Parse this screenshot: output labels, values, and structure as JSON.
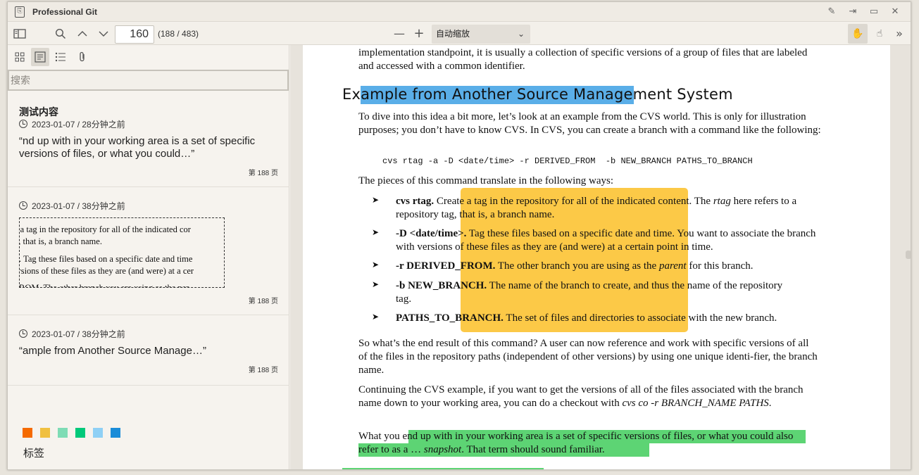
{
  "window": {
    "title": "Professional Git"
  },
  "toolbar": {
    "page_number": "160",
    "page_count": "(188 / 483)",
    "zoom": "自动缩放"
  },
  "sidebar": {
    "search_placeholder": "搜索",
    "notes": [
      {
        "title": "测试内容",
        "date": "2023-01-07 / 28分钟之前",
        "text": "“nd up with in your working area is a set of specific versions of files, or what you could…”",
        "page": "第 188 页"
      },
      {
        "date": "2023-01-07 / 38分钟之前",
        "snapshot_lines": [
          "e a tag in the repository for all of the indicated cor",
          "g, that is, a branch name.",
          ">. Tag these files based on a specific date and time",
          "ersions of these files as they are (and were) at a cer",
          "FROM. The other branch you are using as the par"
        ],
        "page": "第 188 页"
      },
      {
        "date": "2023-01-07 / 38分钟之前",
        "text": "“ample from Another Source Manage…”",
        "page": "第 188 页"
      }
    ],
    "tag_colors": [
      "#f56a00",
      "#f0c040",
      "#7edcb5",
      "#00c97a",
      "#8fd0f5",
      "#1a8cd8"
    ],
    "tag_label": "标签"
  },
  "doc": {
    "intro": "implementation standpoint, it is usually a collection of specific versions of a group of files that are labeled and accessed with a common identifier.",
    "heading": "Example from Another Source Management System",
    "para1": "To dive into this idea a bit more, let’s look at an example from the CVS world. This is only for illustration purposes; you don’t have to know CVS. In CVS, you can create a branch with a command like the following:",
    "code": "cvs rtag -a -D <date/time> -r DERIVED_FROM  -b NEW_BRANCH PATHS_TO_BRANCH",
    "para2": "The pieces of this command translate in the following ways:",
    "items": [
      {
        "term": "cvs rtag.",
        "desc_pre": " Create a tag in the repository for all of the indicated content. The ",
        "em": "rtag",
        "desc_post": " here refers to a repository tag, that is, a branch name."
      },
      {
        "term": "-D <date/time>.",
        "desc_pre": " Tag these files based on a specific date and time. You want to associate the branch with versions of these files as they are (and were) at a certain point in time.",
        "em": "",
        "desc_post": ""
      },
      {
        "term": "-r DERIVED_FROM.",
        "desc_pre": " The other branch you are using as the ",
        "em": "parent",
        "desc_post": " for this branch."
      },
      {
        "term": "-b NEW_BRANCH.",
        "desc_pre": " The name of the branch to create, and thus the name of the repository tag.",
        "em": "",
        "desc_post": ""
      },
      {
        "term": "PATHS_TO_BRANCH.",
        "desc_pre": " The set of files and directories to associate with the new branch.",
        "em": "",
        "desc_post": ""
      }
    ],
    "para3": "So what’s the end result of this command? A user can now reference and work with specific versions of all of the files in the repository paths (independent of other versions) by using one unique identi-fier, the branch name.",
    "para4_pre": "Continuing the CVS example, if you want to get the versions of all of the files associated with the branch name down to your working area, you can do a checkout with ",
    "para4_em": "cvs co -r BRANCH_NAME PATHS",
    "para4_post": ".",
    "para5_pre": "What you e",
    "para5_hl": "nd up with in your working area is a set of specific versions of files, or what you could also refer to as a … ",
    "para5_em": "snapshot",
    "para5_post": ". That term should sound familiar."
  }
}
